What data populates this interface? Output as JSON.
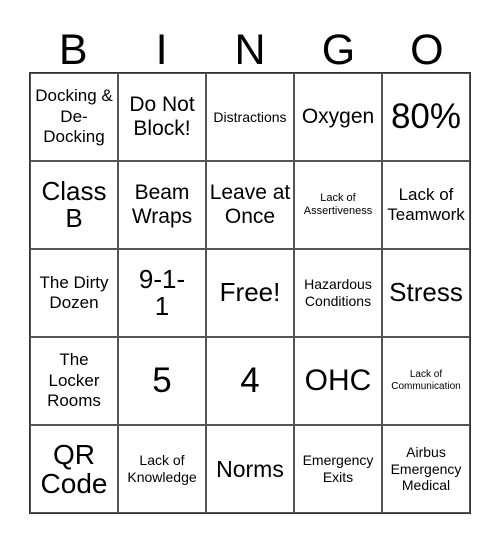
{
  "header": [
    "B",
    "I",
    "N",
    "G",
    "O"
  ],
  "cells": [
    "Docking & De-Docking",
    "Do Not Block!",
    "Distractions",
    "Oxygen",
    "80%",
    "Class B",
    "Beam Wraps",
    "Leave at Once",
    "Lack of Assertiveness",
    "Lack of Teamwork",
    "The Dirty Dozen",
    "9-1-1",
    "Free!",
    "Hazardous Conditions",
    "Stress",
    "The Locker Rooms",
    "5",
    "4",
    "OHC",
    "Lack of Communication",
    "QR Code",
    "Lack of Knowledge",
    "Norms",
    "Emergency Exits",
    "Airbus Emergency Medical"
  ]
}
